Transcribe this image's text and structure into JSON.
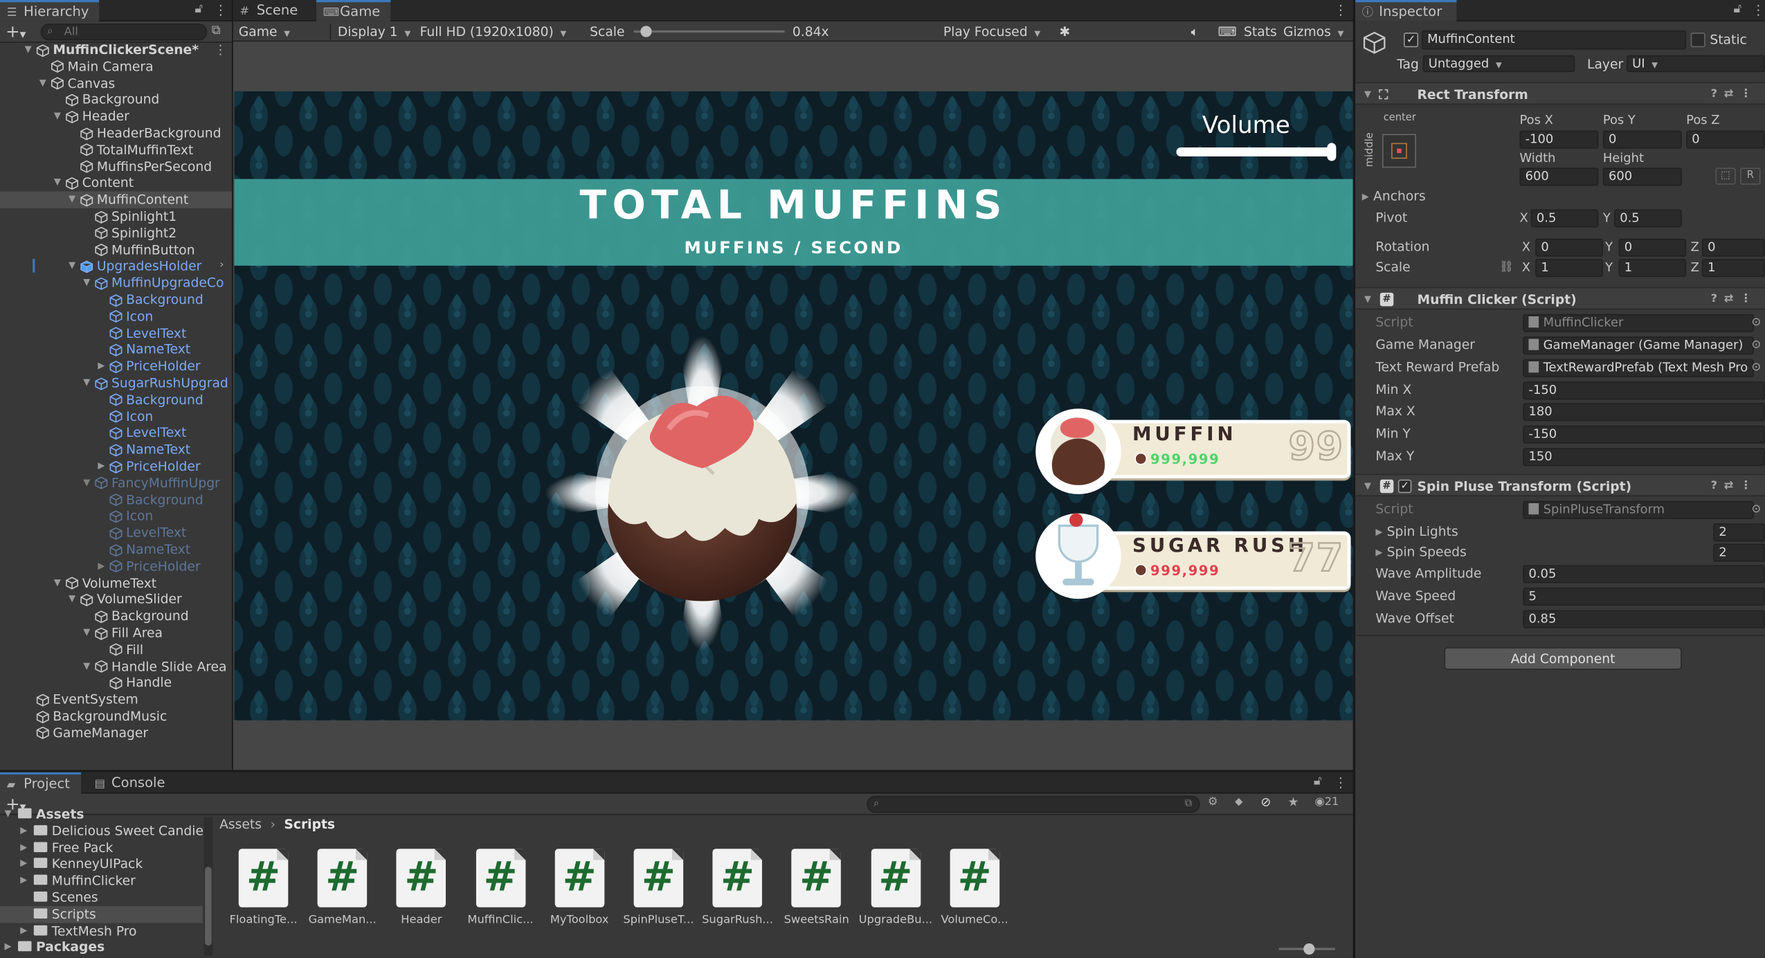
{
  "hierarchy": {
    "tab": "Hierarchy",
    "search_placeholder": "All",
    "items": [
      {
        "label": "MuffinClickerScene*"
      },
      {
        "label": "Main Camera"
      },
      {
        "label": "Canvas"
      },
      {
        "label": "Background"
      },
      {
        "label": "Header"
      },
      {
        "label": "HeaderBackground"
      },
      {
        "label": "TotalMuffinText"
      },
      {
        "label": "MuffinsPerSecond"
      },
      {
        "label": "Content"
      },
      {
        "label": "MuffinContent"
      },
      {
        "label": "Spinlight1"
      },
      {
        "label": "Spinlight2"
      },
      {
        "label": "MuffinButton"
      },
      {
        "label": "UpgradesHolder"
      },
      {
        "label": "MuffinUpgradeCo"
      },
      {
        "label": "Background"
      },
      {
        "label": "Icon"
      },
      {
        "label": "LevelText"
      },
      {
        "label": "NameText"
      },
      {
        "label": "PriceHolder"
      },
      {
        "label": "SugarRushUpgrad"
      },
      {
        "label": "Background"
      },
      {
        "label": "Icon"
      },
      {
        "label": "LevelText"
      },
      {
        "label": "NameText"
      },
      {
        "label": "PriceHolder"
      },
      {
        "label": "FancyMuffinUpgr"
      },
      {
        "label": "Background"
      },
      {
        "label": "Icon"
      },
      {
        "label": "LevelText"
      },
      {
        "label": "NameText"
      },
      {
        "label": "PriceHolder"
      },
      {
        "label": "VolumeText"
      },
      {
        "label": "VolumeSlider"
      },
      {
        "label": "Background"
      },
      {
        "label": "Fill Area"
      },
      {
        "label": "Fill"
      },
      {
        "label": "Handle Slide Area"
      },
      {
        "label": "Handle"
      },
      {
        "label": "EventSystem"
      },
      {
        "label": "BackgroundMusic"
      },
      {
        "label": "GameManager"
      }
    ]
  },
  "scene_tabs": {
    "scene": "Scene",
    "game": "Game"
  },
  "game_toolbar": {
    "mode": "Game",
    "display": "Display 1",
    "resolution": "Full HD (1920x1080)",
    "scale_label": "Scale",
    "scale_value": "0.84x",
    "scale_fraction": 0.05,
    "play_focus": "Play Focused",
    "stats": "Stats",
    "gizmos": "Gizmos"
  },
  "game": {
    "title": "TOTAL MUFFINS",
    "subtitle": "MUFFINS / SECOND",
    "volume_label": "Volume",
    "volume_fraction": 1.0,
    "upgrades": [
      {
        "name": "MUFFIN",
        "price": "999,999",
        "level": "99",
        "price_color": "#4fd46a"
      },
      {
        "name": "SUGAR RUSH",
        "price": "999,999",
        "level": "77",
        "price_color": "#e04050"
      }
    ]
  },
  "inspector": {
    "tab": "Inspector",
    "object_name": "MuffinContent",
    "static_label": "Static",
    "tag_label": "Tag",
    "tag_value": "Untagged",
    "layer_label": "Layer",
    "layer_value": "UI",
    "rect": {
      "title": "Rect Transform",
      "anchor_h": "center",
      "anchor_v": "middle",
      "posx_label": "Pos X",
      "posy_label": "Pos Y",
      "posz_label": "Pos Z",
      "posx": "-100",
      "posy": "0",
      "posz": "0",
      "width_label": "Width",
      "height_label": "Height",
      "width": "600",
      "height": "600",
      "anchors": "Anchors",
      "pivot": "Pivot",
      "pivot_x": "0.5",
      "pivot_y": "0.5",
      "rotation": "Rotation",
      "rot_x": "0",
      "rot_y": "0",
      "rot_z": "0",
      "scale": "Scale",
      "scale_x": "1",
      "scale_y": "1",
      "scale_z": "1"
    },
    "muffin_clicker": {
      "title": "Muffin Clicker (Script)",
      "fields": [
        {
          "k": "Script",
          "v": "MuffinClicker"
        },
        {
          "k": "Game Manager",
          "v": "GameManager (Game Manager)"
        },
        {
          "k": "Text Reward Prefab",
          "v": "TextRewardPrefab (Text Mesh Pro"
        },
        {
          "k": "Min X",
          "v": "-150"
        },
        {
          "k": "Max X",
          "v": "180"
        },
        {
          "k": "Min Y",
          "v": "-150"
        },
        {
          "k": "Max Y",
          "v": "150"
        }
      ]
    },
    "spin": {
      "title": "Spin Pluse Transform (Script)",
      "fields": [
        {
          "k": "Script",
          "v": "SpinPluseTransform"
        },
        {
          "k": "Spin Lights",
          "v": "2"
        },
        {
          "k": "Spin Speeds",
          "v": "2"
        },
        {
          "k": "Wave Amplitude",
          "v": "0.05"
        },
        {
          "k": "Wave Speed",
          "v": "5"
        },
        {
          "k": "Wave Offset",
          "v": "0.85"
        }
      ]
    },
    "add_component": "Add Component"
  },
  "project": {
    "tabs": [
      "Project",
      "Console"
    ],
    "hidden_count": "21",
    "folders": [
      "Assets",
      "Delicious Sweet Candies",
      "Free Pack",
      "KenneyUIPack",
      "MuffinClicker",
      "Scenes",
      "Scripts",
      "TextMesh Pro",
      "Packages"
    ],
    "breadcrumb": [
      "Assets",
      "Scripts"
    ],
    "assets": [
      "FloatingTe...",
      "GameMan...",
      "Header",
      "MuffinClic...",
      "MyToolbox",
      "SpinPluseT...",
      "SugarRush...",
      "SweetsRain",
      "UpgradeBu...",
      "VolumeCo..."
    ]
  },
  "colors": {
    "accent": "#3a79bb",
    "header_band": "#3e9c95",
    "prefab_blue": "#7baaf7"
  }
}
